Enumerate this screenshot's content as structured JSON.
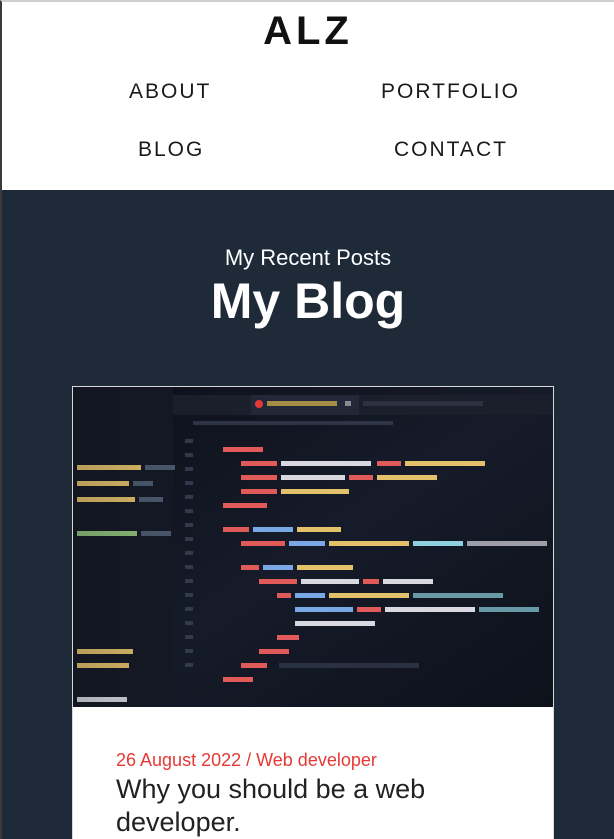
{
  "site": {
    "logo": "ALZ"
  },
  "nav": {
    "about": "ABOUT",
    "portfolio": "PORTFOLIO",
    "blog": "BLOG",
    "contact": "CONTACT"
  },
  "hero": {
    "subtitle": "My Recent Posts",
    "title": "My Blog"
  },
  "post": {
    "meta": "26 August 2022 / Web developer",
    "title": "Why you should be a web developer.",
    "image_icon": "code-editor-photo"
  },
  "colors": {
    "main_background": "#1e2a38",
    "accent_red": "#e53935"
  }
}
